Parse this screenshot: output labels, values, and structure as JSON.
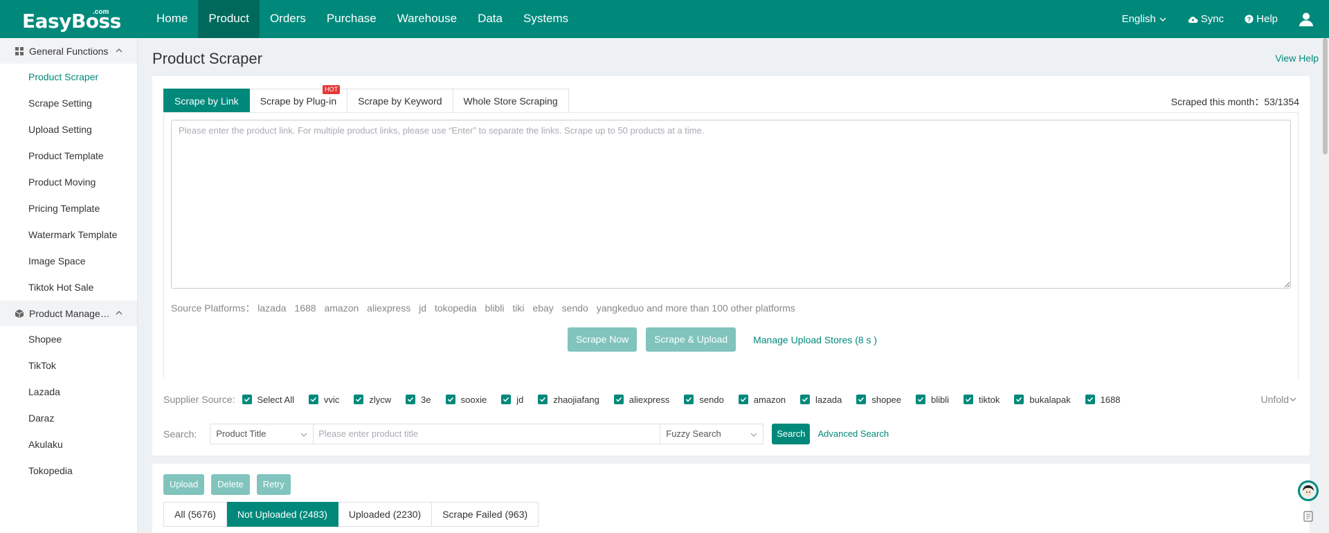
{
  "app": {
    "brand": "EasyBoss",
    "brand_suffix": ".com"
  },
  "topnav": {
    "items": [
      {
        "label": "Home",
        "active": false
      },
      {
        "label": "Product",
        "active": true
      },
      {
        "label": "Orders",
        "active": false
      },
      {
        "label": "Purchase",
        "active": false
      },
      {
        "label": "Warehouse",
        "active": false
      },
      {
        "label": "Data",
        "active": false
      },
      {
        "label": "Systems",
        "active": false
      }
    ],
    "language": "English",
    "sync": "Sync",
    "help": "Help"
  },
  "sidebar": {
    "groups": [
      {
        "label": "General Functions",
        "icon": "grid-icon",
        "items": [
          "Product Scraper",
          "Scrape Setting",
          "Upload Setting",
          "Product Template",
          "Product Moving",
          "Pricing Template",
          "Watermark Template",
          "Image Space",
          "Tiktok Hot Sale"
        ]
      },
      {
        "label": "Product Managem...",
        "icon": "cube-icon",
        "items": [
          "Shopee",
          "TikTok",
          "Lazada",
          "Daraz",
          "Akulaku",
          "Tokopedia"
        ]
      }
    ],
    "active_item": "Product Scraper"
  },
  "page": {
    "title": "Product Scraper",
    "view_help": "View Help"
  },
  "scraper": {
    "tabs": [
      "Scrape by Link",
      "Scrape by Plug-in",
      "Scrape by Keyword",
      "Whole Store Scraping"
    ],
    "active_tab": "Scrape by Link",
    "hot_badge": "HOT",
    "scraped_label": "Scraped this month：",
    "scraped_value": "53/1354",
    "textarea_placeholder": "Please enter the product link. For multiple product links, please use “Enter” to separate the links. Scrape up to 50 products at a time.",
    "sources_label": "Source Platforms：",
    "platforms": [
      "lazada",
      "1688",
      "amazon",
      "aliexpress",
      "jd",
      "tokopedia",
      "blibli",
      "tiki",
      "ebay",
      "sendo",
      "yangkeduo and more than 100 other platforms"
    ],
    "scrape_now": "Scrape Now",
    "scrape_upload": "Scrape & Upload",
    "manage_stores": "Manage Upload Stores (8 s )"
  },
  "filters": {
    "supplier_label": "Supplier Source:",
    "suppliers": [
      "Select All",
      "vvic",
      "zlycw",
      "3e",
      "sooxie",
      "jd",
      "zhaojiafang",
      "aliexpress",
      "sendo",
      "amazon",
      "lazada",
      "shopee",
      "blibli",
      "tiktok",
      "bukalapak",
      "1688"
    ],
    "unfold": "Unfold",
    "search_label": "Search:",
    "field_select": "Product Title",
    "search_placeholder": "Please enter product title",
    "mode_select": "Fuzzy Search",
    "search_button": "Search",
    "advanced": "Advanced Search"
  },
  "results": {
    "actions": [
      "Upload",
      "Delete",
      "Retry"
    ],
    "status_tabs": [
      "All (5676)",
      "Not Uploaded (2483)",
      "Uploaded (2230)",
      "Scrape Failed (963)"
    ],
    "active_status": "Not Uploaded (2483)"
  },
  "colors": {
    "brand": "#00897b",
    "brand_dark": "#00695c",
    "hot": "#e53935",
    "disabled_button": "#80c4bd"
  }
}
